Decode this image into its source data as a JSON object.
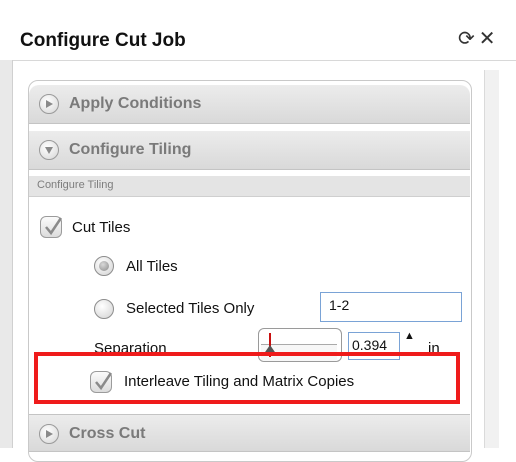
{
  "window": {
    "title": "Configure Cut Job",
    "icons": [
      "refresh-icon",
      "close-icon"
    ]
  },
  "sections": {
    "apply_conditions": {
      "label": "Apply Conditions",
      "expanded": false
    },
    "configure_tiling": {
      "label": "Configure Tiling",
      "expanded": true,
      "sub_label": "Configure Tiling"
    },
    "cross_cut": {
      "label": "Cross Cut",
      "expanded": false
    }
  },
  "tiling": {
    "cut_tiles": {
      "label": "Cut Tiles",
      "checked": true
    },
    "all_tiles": {
      "label": "All Tiles",
      "selected": true
    },
    "selected_tiles": {
      "label": "Selected Tiles Only",
      "selected": false,
      "value": "1-2"
    },
    "separation": {
      "label": "Separation",
      "value": "0.394",
      "unit": "in"
    },
    "interleave": {
      "label": "Interleave Tiling and Matrix Copies",
      "checked": true
    }
  },
  "colors": {
    "highlight": "#ef1b1b",
    "field_border": "#7aa3d6"
  }
}
